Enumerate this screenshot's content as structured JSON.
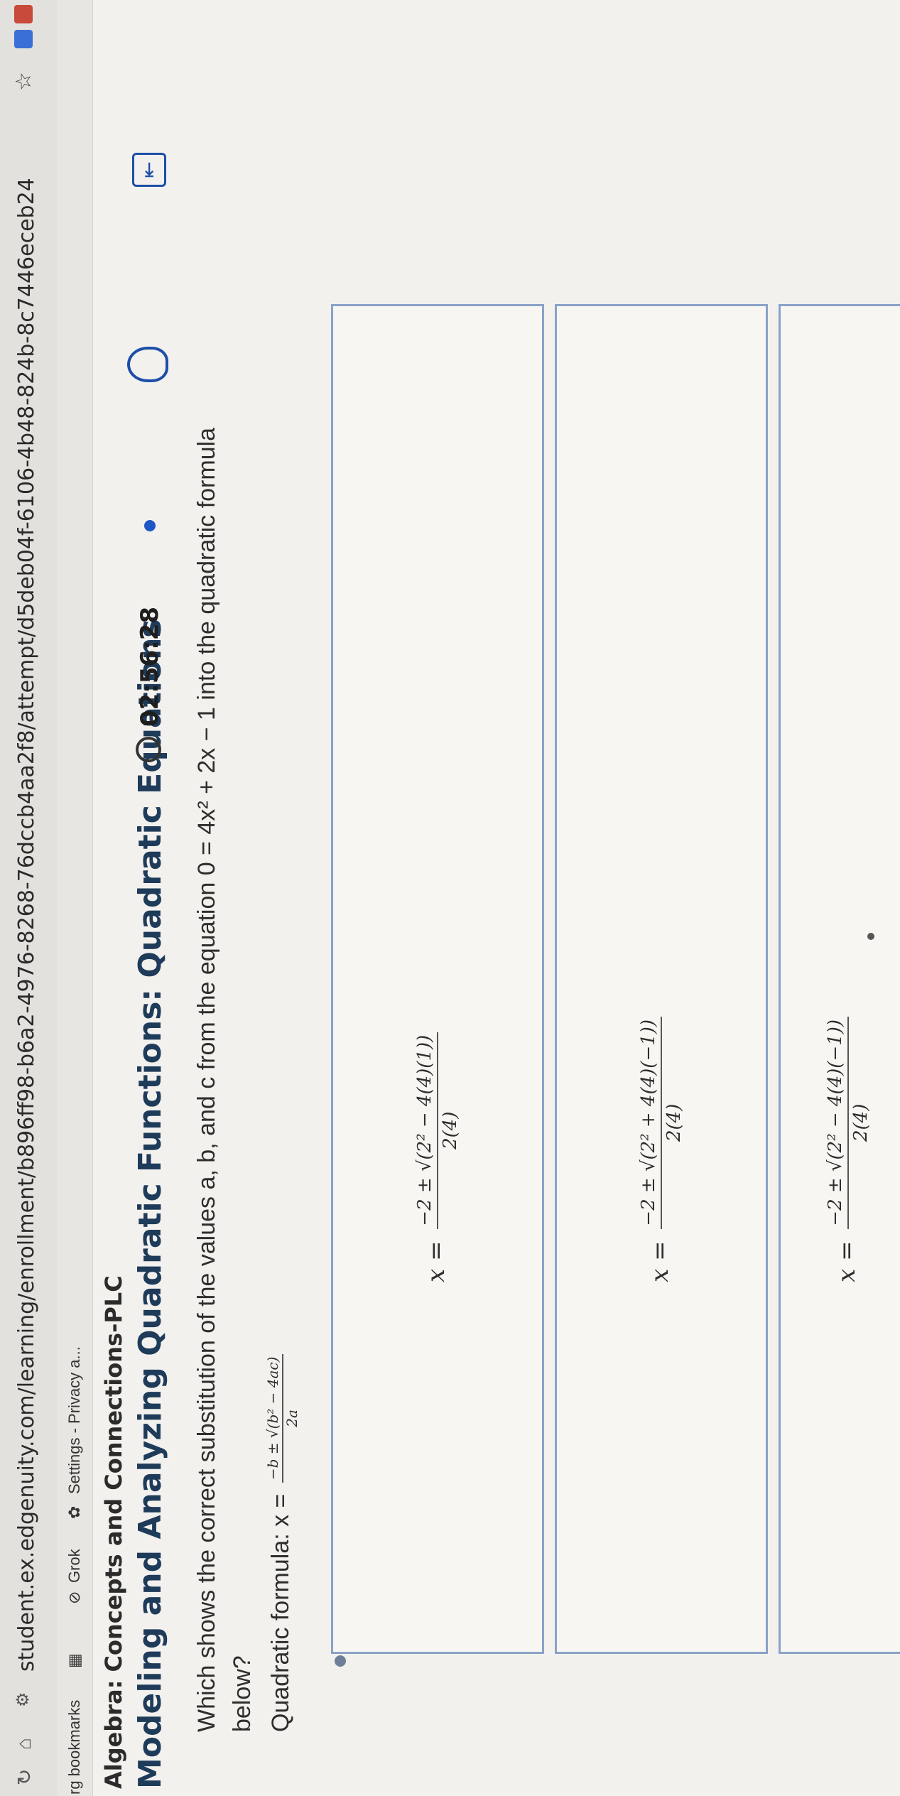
{
  "browser": {
    "url": "student.ex.edgenuity.com/learning/enrollment/b896ff98-b6a2-4976-8268-76dccb4aa2f8/attempt/d5deb04f-6106-4b48-824b-8c7446eceb24",
    "bookmarks": [
      "rg bookmarks",
      "Grok",
      "Settings - Privacy a..."
    ]
  },
  "header": {
    "course_title": "Algebra: Concepts and Connections-PLC",
    "lesson_title": "Modeling and Analyzing Quadratic Functions: Quadratic Equations",
    "timer": "02:56:28"
  },
  "question": {
    "prompt": "Which shows the correct substitution of the values a, b, and c from the equation 0 = 4x² + 2x − 1 into the quadratic formula below?",
    "formula_label": "Quadratic formula: x =",
    "formula_num": "−b ± √(b² − 4ac)",
    "formula_den": "2a"
  },
  "options": [
    {
      "prefix": "x =",
      "num": "−2 ± √(2² − 4(4)(1))",
      "den": "2(4)"
    },
    {
      "prefix": "x =",
      "num": "−2 ± √(2² + 4(4)(−1))",
      "den": "2(4)"
    },
    {
      "prefix": "x =",
      "num": "−2 ± √(2² − 4(4)(−1))",
      "den": "2(4)"
    }
  ],
  "colors": {
    "accent": "#1d4ea8",
    "option_border": "#8aa2c8",
    "title": "#1f3b5a"
  }
}
